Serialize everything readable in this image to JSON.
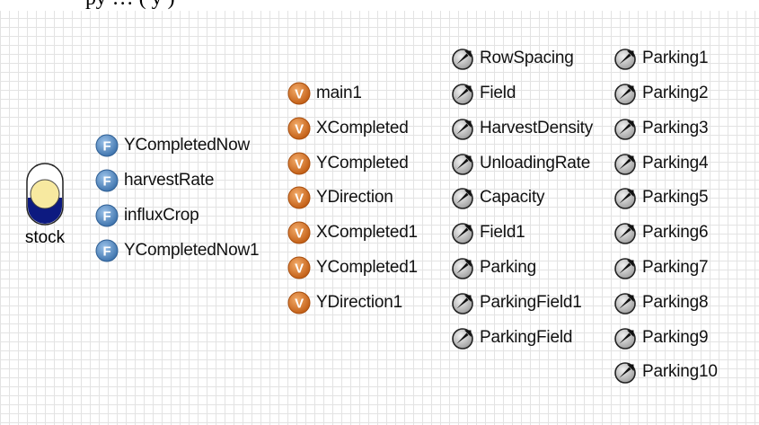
{
  "top_text": "ру … (  у    )",
  "stock": {
    "label": "stock"
  },
  "functions": [
    {
      "label": "YCompletedNow"
    },
    {
      "label": "harvestRate"
    },
    {
      "label": "influxCrop"
    },
    {
      "label": "YCompletedNow1"
    }
  ],
  "variables": [
    {
      "label": "main1"
    },
    {
      "label": "XCompleted"
    },
    {
      "label": "YCompleted"
    },
    {
      "label": "YDirection"
    },
    {
      "label": "XCompleted1"
    },
    {
      "label": "YCompleted1"
    },
    {
      "label": "YDirection1"
    }
  ],
  "parameters_col1": [
    {
      "label": "RowSpacing"
    },
    {
      "label": "Field"
    },
    {
      "label": "HarvestDensity"
    },
    {
      "label": "UnloadingRate"
    },
    {
      "label": "Capacity"
    },
    {
      "label": "Field1"
    },
    {
      "label": "Parking"
    },
    {
      "label": "ParkingField1"
    },
    {
      "label": "ParkingField"
    }
  ],
  "parameters_col2": [
    {
      "label": "Parking1"
    },
    {
      "label": "Parking2"
    },
    {
      "label": "Parking3"
    },
    {
      "label": "Parking4"
    },
    {
      "label": "Parking5"
    },
    {
      "label": "Parking6"
    },
    {
      "label": "Parking7"
    },
    {
      "label": "Parking8"
    },
    {
      "label": "Parking9"
    },
    {
      "label": "Parking10"
    }
  ],
  "colors": {
    "function_icon": "#5a8fc4",
    "variable_icon": "#d9752a",
    "stock_fill": "#f7e9a0",
    "stock_dark": "#0d1a80",
    "grid": "#e3e3e3"
  },
  "icons": {
    "stock": "stock-icon",
    "function": "function-icon",
    "variable": "variable-icon",
    "parameter": "parameter-icon"
  }
}
